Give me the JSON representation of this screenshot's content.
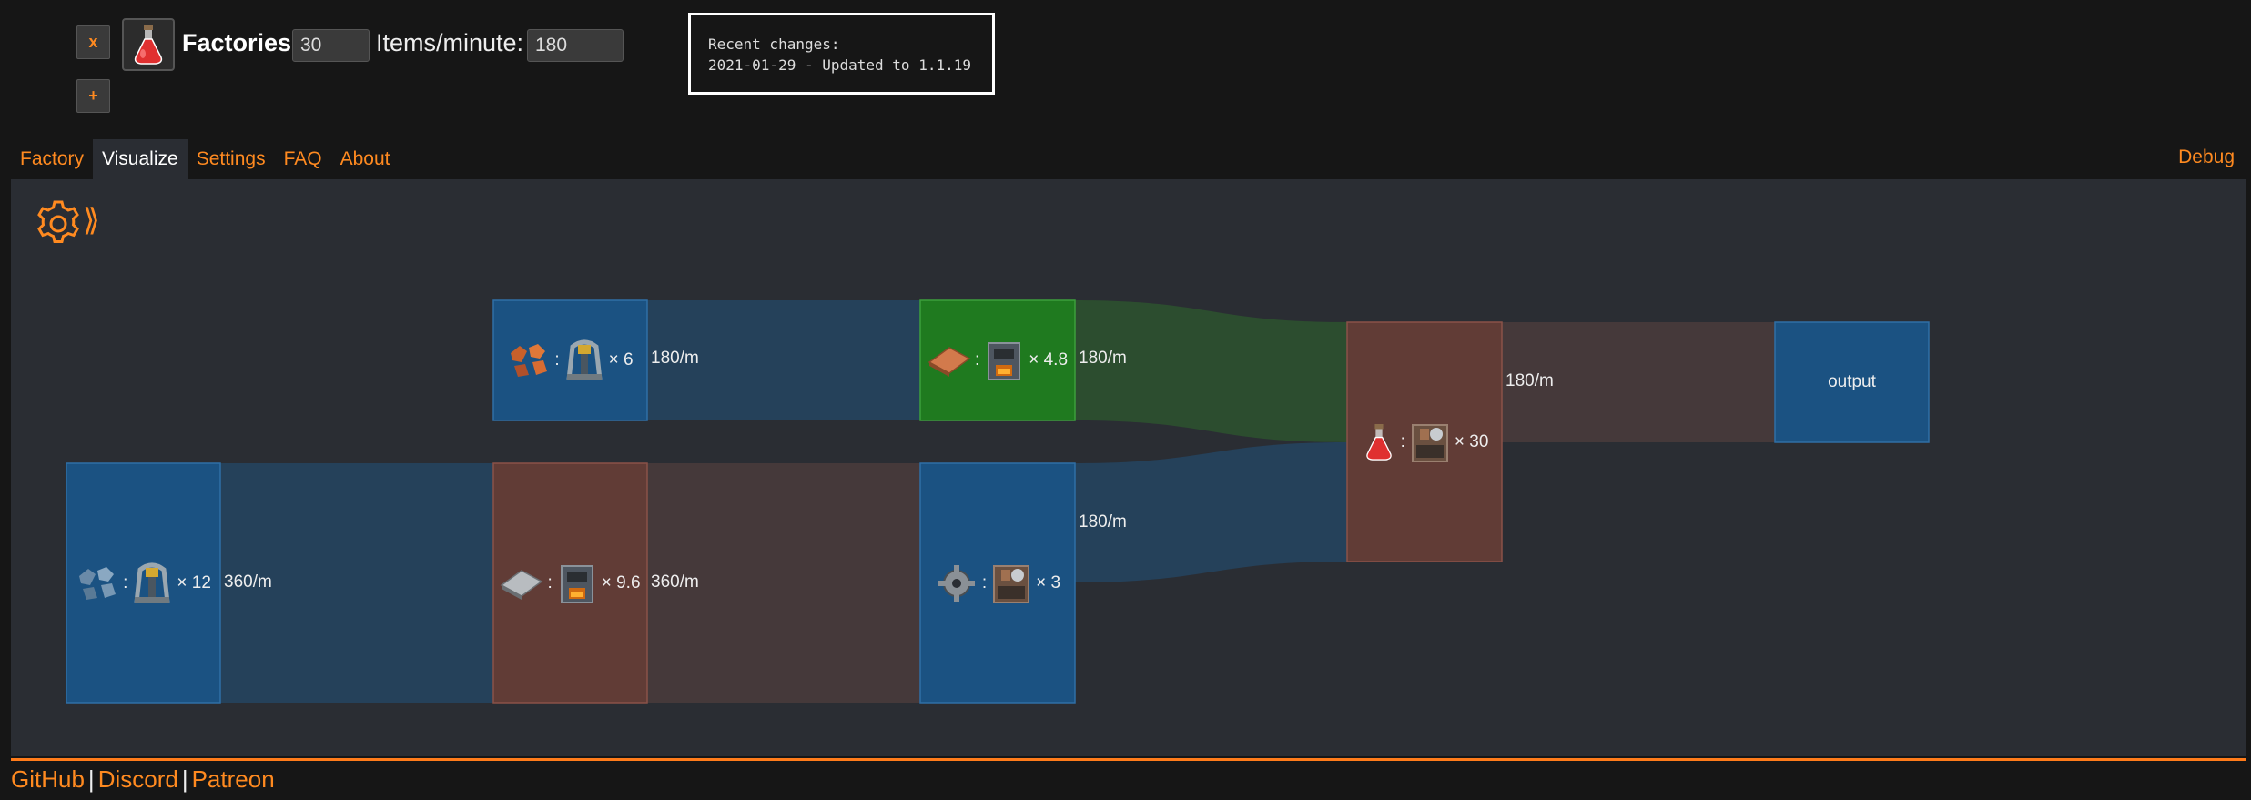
{
  "header": {
    "remove_label": "x",
    "add_label": "+",
    "factories_label": "Factories:",
    "factories_value": "30",
    "items_label": "Items/minute:",
    "items_value": "180",
    "item_icon": "red-science-flask-icon"
  },
  "recent_changes": {
    "title": "Recent changes:",
    "entry": "2021-01-29 - Updated to 1.1.19"
  },
  "tabs": [
    {
      "label": "Factory"
    },
    {
      "label": "Visualize",
      "active": true
    },
    {
      "label": "Settings"
    },
    {
      "label": "FAQ"
    },
    {
      "label": "About"
    }
  ],
  "debug_label": "Debug",
  "chevron": "⟫",
  "graph": {
    "nodes": {
      "copper_ore": {
        "icon": "copper-ore-icon",
        "building": "mining-drill-icon",
        "mult": "× 6"
      },
      "copper_plate": {
        "icon": "copper-plate-icon",
        "building": "furnace-icon",
        "mult": "× 4.8"
      },
      "iron_ore": {
        "icon": "iron-ore-icon",
        "building": "mining-drill-icon",
        "mult": "× 12"
      },
      "iron_plate": {
        "icon": "iron-plate-icon",
        "building": "furnace-icon",
        "mult": "× 9.6"
      },
      "gear": {
        "icon": "gear-wheel-icon",
        "building": "assembler-icon",
        "mult": "× 3"
      },
      "science": {
        "icon": "red-science-flask-icon",
        "building": "assembler-icon",
        "mult": "× 30"
      },
      "output": {
        "label": "output"
      }
    },
    "flows": {
      "copper_ore_to_plate": "180/m",
      "copper_plate_to_science": "180/m",
      "iron_ore_to_plate": "360/m",
      "iron_plate_to_gear": "360/m",
      "gear_to_science": "180/m",
      "science_to_output": "180/m"
    },
    "colors": {
      "blue_node": "#1b5282",
      "green_node": "#1f7a1f",
      "brown_node": "#613c36",
      "blue_link": "#25415a",
      "green_link": "#2c4d2f",
      "brown_link": "#45393a"
    },
    "colon": ":"
  },
  "footer": {
    "github": "GitHub",
    "discord": "Discord",
    "patreon": "Patreon",
    "separator": "|"
  },
  "colors": {
    "accent": "#ff8a20",
    "background": "#161616",
    "panel": "#2a2d33"
  }
}
